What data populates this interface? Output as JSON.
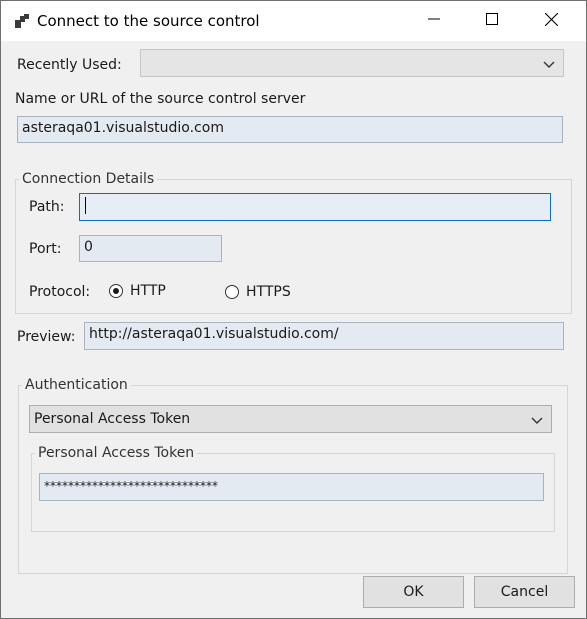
{
  "window": {
    "title": "Connect to the source control",
    "app_icon": "app-icon",
    "controls": [
      "minimize-icon",
      "maximize-icon",
      "close-icon"
    ]
  },
  "recently_used": {
    "label": "Recently Used:",
    "value": ""
  },
  "server": {
    "label": "Name or URL of the source control  server",
    "value": "asteraqa01.visualstudio.com"
  },
  "connection_details": {
    "legend": "Connection Details",
    "path": {
      "label": "Path:",
      "value": ""
    },
    "port": {
      "label": "Port:",
      "value": "0"
    },
    "protocol": {
      "label": "Protocol:",
      "options": [
        {
          "label": "HTTP",
          "selected": true
        },
        {
          "label": "HTTPS",
          "selected": false
        }
      ]
    }
  },
  "preview": {
    "label": "Preview:",
    "value": "http://asteraqa01.visualstudio.com/"
  },
  "authentication": {
    "legend": "Authentication",
    "method": "Personal Access Token",
    "token_group": {
      "legend": "Personal Access Token",
      "value": "*****************************"
    }
  },
  "buttons": {
    "ok": "OK",
    "cancel": "Cancel"
  },
  "colors": {
    "input_background": "#e3eaf1",
    "focus_border": "#0a6cd0",
    "window_background": "#f0f0f0"
  }
}
